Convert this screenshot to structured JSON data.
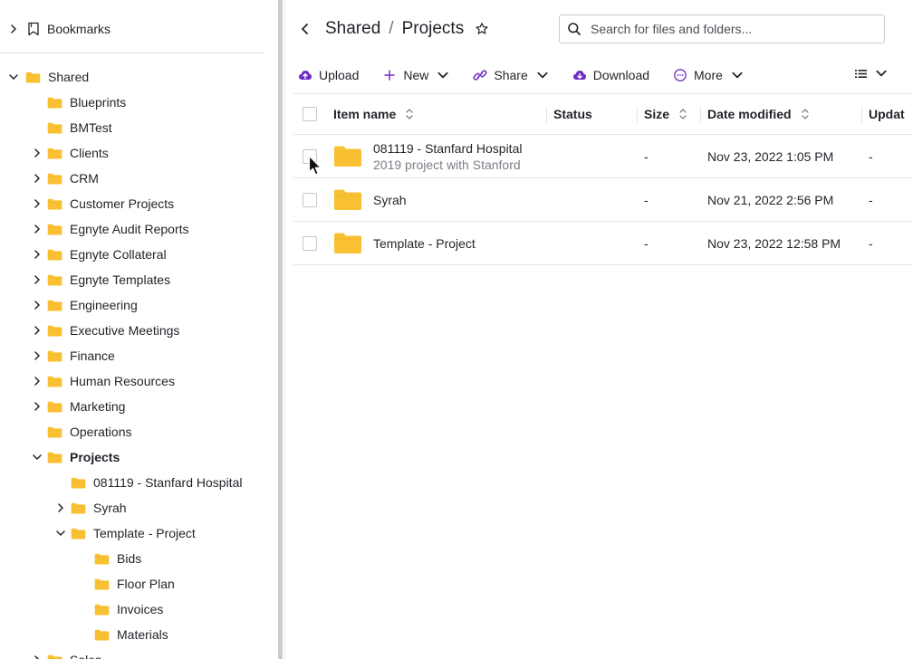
{
  "sidebar": {
    "bookmarks_label": "Bookmarks",
    "root_label": "Shared",
    "items": [
      {
        "label": "Blueprints",
        "expandable": false
      },
      {
        "label": "BMTest",
        "expandable": false
      },
      {
        "label": "Clients",
        "expandable": true
      },
      {
        "label": "CRM",
        "expandable": true
      },
      {
        "label": "Customer Projects",
        "expandable": true
      },
      {
        "label": "Egnyte Audit Reports",
        "expandable": true
      },
      {
        "label": "Egnyte Collateral",
        "expandable": true
      },
      {
        "label": "Egnyte Templates",
        "expandable": true
      },
      {
        "label": "Engineering",
        "expandable": true
      },
      {
        "label": "Executive Meetings",
        "expandable": true
      },
      {
        "label": "Finance",
        "expandable": true
      },
      {
        "label": "Human Resources",
        "expandable": true
      },
      {
        "label": "Marketing",
        "expandable": true
      },
      {
        "label": "Operations",
        "expandable": false
      },
      {
        "label": "Projects",
        "expandable": true
      },
      {
        "label": "081119 - Stanfard Hospital",
        "expandable": false
      },
      {
        "label": "Syrah",
        "expandable": true
      },
      {
        "label": "Template - Project",
        "expandable": true
      },
      {
        "label": "Bids",
        "expandable": false
      },
      {
        "label": "Floor Plan",
        "expandable": false
      },
      {
        "label": "Invoices",
        "expandable": false
      },
      {
        "label": "Materials",
        "expandable": false
      },
      {
        "label": "Sales",
        "expandable": true
      }
    ]
  },
  "header": {
    "breadcrumb_parent": "Shared",
    "breadcrumb_separator": "/",
    "breadcrumb_current": "Projects",
    "search_placeholder": "Search for files and folders..."
  },
  "toolbar": {
    "upload": "Upload",
    "new": "New",
    "share": "Share",
    "download": "Download",
    "more": "More"
  },
  "table": {
    "columns": {
      "name": "Item name",
      "status": "Status",
      "size": "Size",
      "date": "Date modified",
      "updated": "Updat"
    },
    "rows": [
      {
        "name": "081119 - Stanfard Hospital",
        "description": "2019 project with Stanford",
        "status": "",
        "size": "-",
        "date": "Nov 23, 2022 1:05 PM",
        "updated": "-"
      },
      {
        "name": "Syrah",
        "description": "",
        "status": "",
        "size": "-",
        "date": "Nov 21, 2022 2:56 PM",
        "updated": "-"
      },
      {
        "name": "Template - Project",
        "description": "",
        "status": "",
        "size": "-",
        "date": "Nov 23, 2022 12:58 PM",
        "updated": "-"
      }
    ]
  },
  "colors": {
    "folder": "#F9C033",
    "accent_purple": "#6E2FC2",
    "border": "#E4E6E8"
  }
}
